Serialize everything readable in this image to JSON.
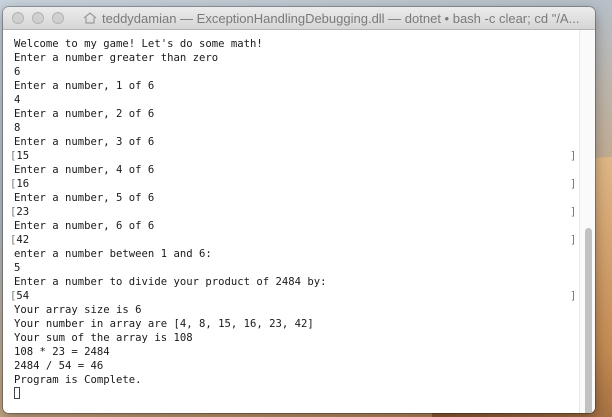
{
  "window": {
    "title": "teddydamian — ExceptionHandlingDebugging.dll — dotnet • bash -c clear; cd \"/A..."
  },
  "terminal": {
    "lines": [
      {
        "text": "Welcome to my game! Let's do some math!",
        "bracket": false
      },
      {
        "text": "Enter a number greater than zero",
        "bracket": false
      },
      {
        "text": "6",
        "bracket": false
      },
      {
        "text": "Enter a number, 1 of 6",
        "bracket": false
      },
      {
        "text": "4",
        "bracket": false
      },
      {
        "text": "Enter a number, 2 of 6",
        "bracket": false
      },
      {
        "text": "8",
        "bracket": false
      },
      {
        "text": "Enter a number, 3 of 6",
        "bracket": false
      },
      {
        "text": "15",
        "bracket": true
      },
      {
        "text": "Enter a number, 4 of 6",
        "bracket": false
      },
      {
        "text": "16",
        "bracket": true
      },
      {
        "text": "Enter a number, 5 of 6",
        "bracket": false
      },
      {
        "text": "23",
        "bracket": true
      },
      {
        "text": "Enter a number, 6 of 6",
        "bracket": false
      },
      {
        "text": "42",
        "bracket": true
      },
      {
        "text": "enter a number between 1 and 6:",
        "bracket": false
      },
      {
        "text": "5",
        "bracket": false
      },
      {
        "text": "Enter a number to divide your product of 2484 by:",
        "bracket": false
      },
      {
        "text": "54",
        "bracket": true
      },
      {
        "text": "Your array size is 6",
        "bracket": false
      },
      {
        "text": "Your number in array are [4, 8, 15, 16, 23, 42]",
        "bracket": false
      },
      {
        "text": "Your sum of the array is 108",
        "bracket": false
      },
      {
        "text": "108 * 23 = 2484",
        "bracket": false
      },
      {
        "text": "2484 / 54 = 46",
        "bracket": false
      },
      {
        "text": "Program is Complete.",
        "bracket": false
      }
    ]
  },
  "colors": {
    "window_bg": "#ffffff",
    "titlebar_text": "#7a7a7a",
    "terminal_text": "#1a1a1a"
  },
  "icons": {
    "title_icon": "home-icon",
    "close": "close-dot-icon",
    "minimize": "minimize-dot-icon",
    "zoom": "zoom-dot-icon"
  }
}
